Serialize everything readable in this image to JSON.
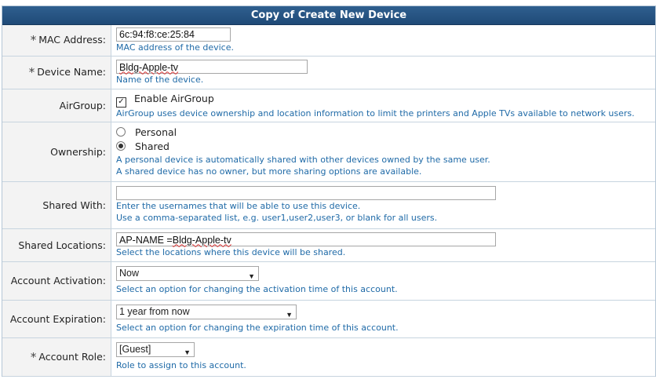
{
  "form": {
    "title": "Copy of Create New Device",
    "required_mark": "*",
    "mac": {
      "label": "MAC Address:",
      "value": "6c:94:f8:ce:25:84",
      "desc": "MAC address of the device."
    },
    "device_name": {
      "label": "Device Name:",
      "value": "Bldg-Apple-tv",
      "desc": "Name of the device."
    },
    "airgroup": {
      "label": "AirGroup:",
      "checkbox_label": "Enable AirGroup",
      "checked": true,
      "desc": "AirGroup uses device ownership and location information to limit the printers and Apple TVs available to network users."
    },
    "ownership": {
      "label": "Ownership:",
      "option_personal": "Personal",
      "option_shared": "Shared",
      "selected": "Shared",
      "desc1": "A personal device is automatically shared with other devices owned by the same user.",
      "desc2": "A shared device has no owner, but more sharing options are available."
    },
    "shared_with": {
      "label": "Shared With:",
      "value": "",
      "desc1": "Enter the usernames that will be able to use this device.",
      "desc2": "Use a comma-separated list, e.g. user1,user2,user3, or blank for all users."
    },
    "shared_locations": {
      "label": "Shared Locations:",
      "value_prefix": "AP-NAME =",
      "value_name": "Bldg-Apple-tv",
      "desc": "Select the locations where this device will be shared."
    },
    "activation": {
      "label": "Account Activation:",
      "value": "Now",
      "desc": "Select an option for changing the activation time of this account."
    },
    "expiration": {
      "label": "Account Expiration:",
      "value": "1 year from now",
      "desc": "Select an option for changing the expiration time of this account."
    },
    "role": {
      "label": "Account Role:",
      "value": "[Guest]",
      "desc": "Role to assign to this account."
    }
  }
}
